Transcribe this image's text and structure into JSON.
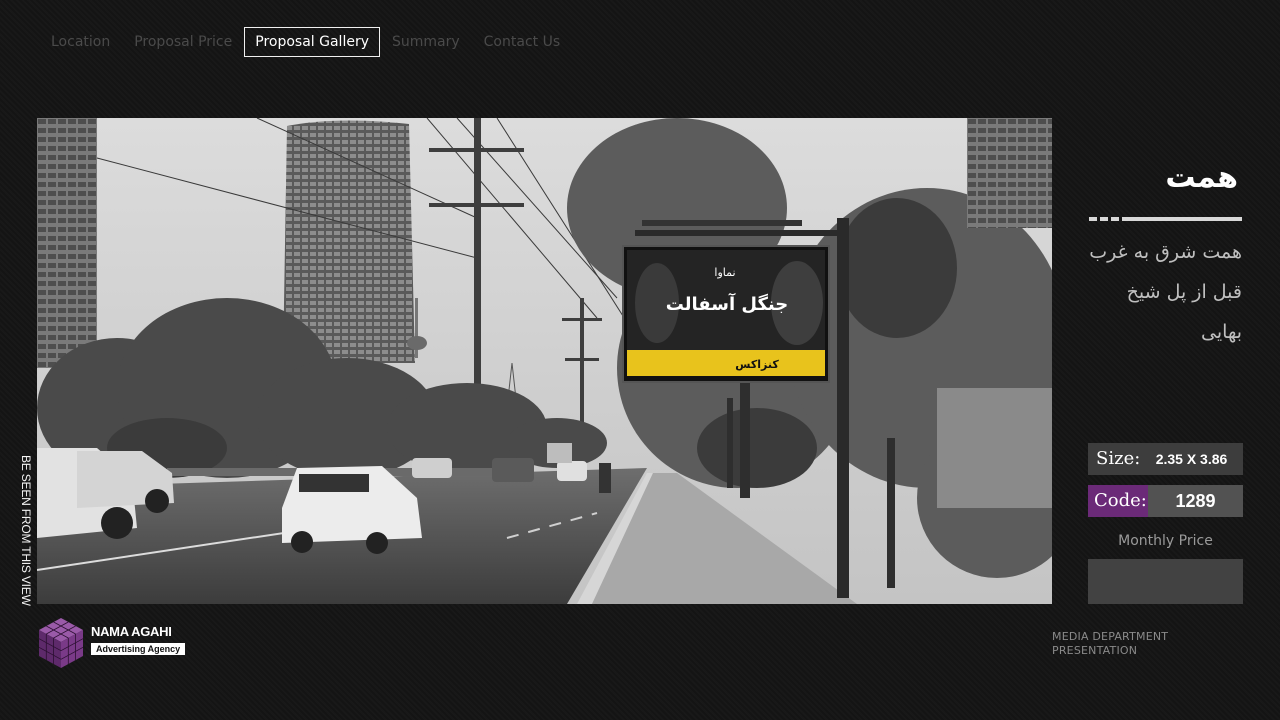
{
  "nav": {
    "items": [
      {
        "label": "Location",
        "active": false
      },
      {
        "label": "Proposal Price",
        "active": false
      },
      {
        "label": "Proposal Gallery",
        "active": true
      },
      {
        "label": "Summary",
        "active": false
      },
      {
        "label": "Contact Us",
        "active": false
      }
    ]
  },
  "photo": {
    "vertical_caption": "BE SEEN FROM THIS VIEW",
    "billboard": {
      "brand": "نماوا",
      "title": "جنگل آسفالت",
      "footer_text": "کنزاکس",
      "strip_color": "#e8c31c"
    }
  },
  "panel": {
    "title": "همت",
    "description": "همت شرق به غرب قبل از پل شیخ بهایی",
    "size_label": "Size:",
    "size_value": "2.35 X 3.86",
    "code_label": "Code:",
    "code_value": "1289",
    "price_label": "Monthly Price",
    "price_value": ""
  },
  "footer": {
    "logo_name": "NAMA AGAHI",
    "logo_sub": "Advertising Agency",
    "dept_line1": "MEDIA DEPARTMENT",
    "dept_line2": "PRESENTATION"
  },
  "colors": {
    "background": "#141414",
    "accent_purple": "#6b2a78",
    "panel_gray": "#3d3d3d",
    "code_value_gray": "#525252"
  }
}
